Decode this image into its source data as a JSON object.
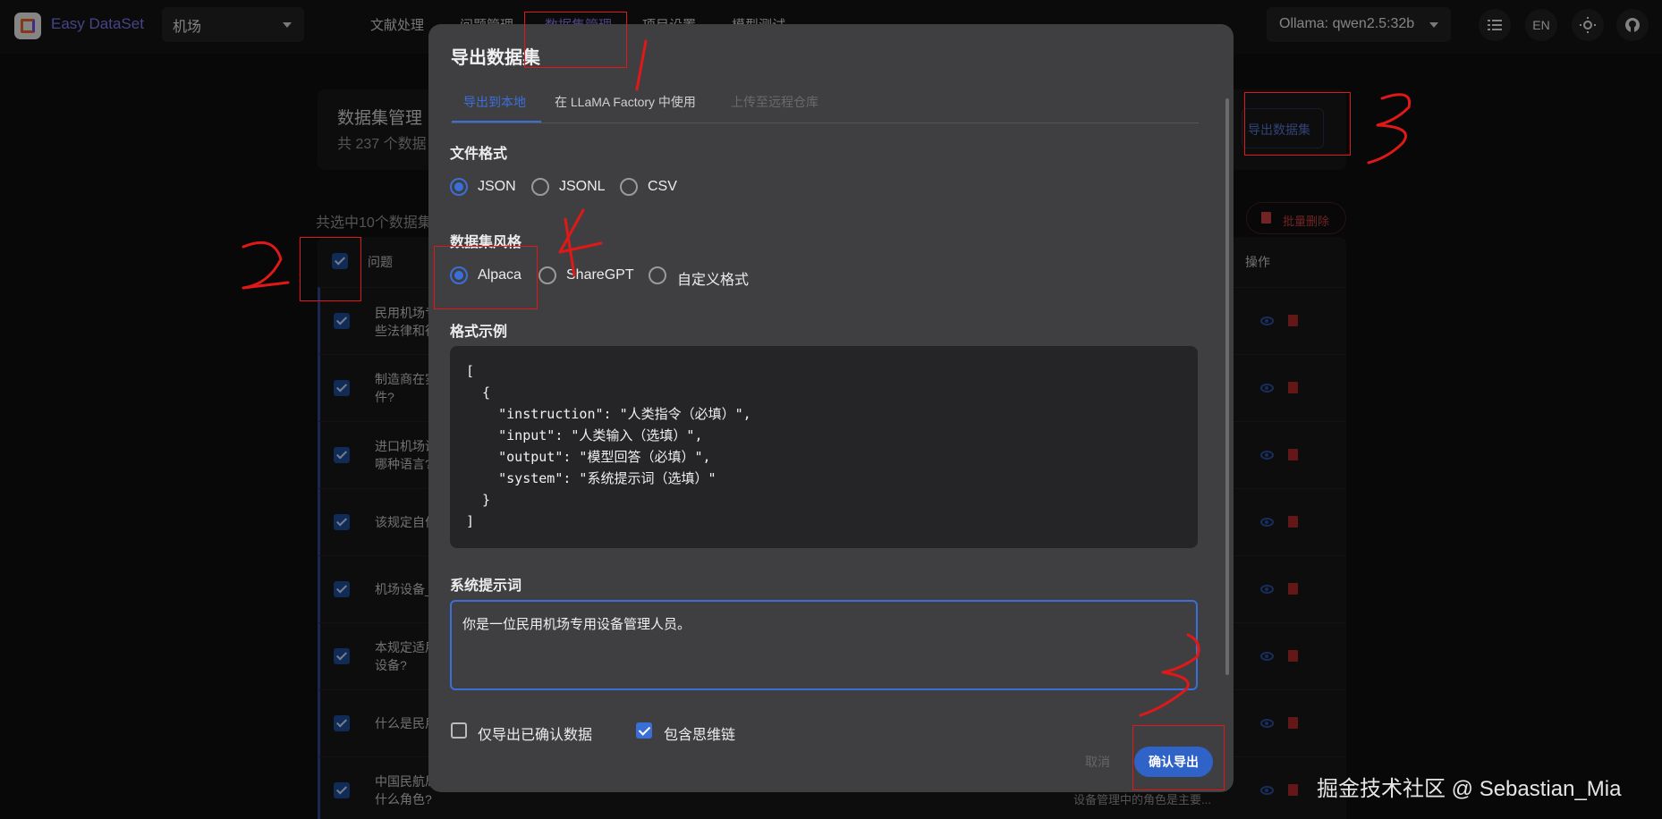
{
  "app": {
    "name": "Easy DataSet",
    "project": "机场"
  },
  "nav": [
    "文献处理",
    "问题管理",
    "数据集管理",
    "项目设置",
    "模型测试"
  ],
  "model": "Ollama: qwen2.5:32b",
  "lang": "EN",
  "page": {
    "title": "数据集管理",
    "subtitle": "共 237 个数据",
    "export_button": "导出数据集",
    "selected": "共选中10个数据集",
    "bulk_delete": "批量删除",
    "col_question": "问题",
    "col_actions": "操作",
    "rows": [
      {
        "l1": "民用机场专",
        "l2": "些法律和行"
      },
      {
        "l1": "制造商在实",
        "l2": "件?"
      },
      {
        "l1": "进口机场设",
        "l2": "哪种语言?"
      },
      {
        "l1": "该规定自何",
        "l2": ""
      },
      {
        "l1": "机场设备_",
        "l2": ""
      },
      {
        "l1": "本规定适用",
        "l2": "设备?"
      },
      {
        "l1": "什么是民用",
        "l2": ""
      },
      {
        "l1": "中国民航局",
        "l2": "什么角色?"
      }
    ],
    "row_tail": "设备管理中的角色是主要..."
  },
  "dialog": {
    "title": "导出数据集",
    "tabs": [
      "导出到本地",
      "在 LLaMA Factory 中使用",
      "上传至远程仓库"
    ],
    "file_format_label": "文件格式",
    "file_formats": [
      "JSON",
      "JSONL",
      "CSV"
    ],
    "file_format_selected": "JSON",
    "style_label": "数据集风格",
    "styles": [
      "Alpaca",
      "ShareGPT",
      "自定义格式"
    ],
    "style_selected": "Alpaca",
    "example_label": "格式示例",
    "example_lines": [
      "[",
      "  {",
      "    \"instruction\": \"人类指令（必填）\",",
      "    \"input\": \"人类输入（选填）\",",
      "    \"output\": \"模型回答（必填）\",",
      "    \"system\": \"系统提示词（选填）\"",
      "  }",
      "]"
    ],
    "system_prompt_label": "系统提示词",
    "system_prompt_value": "你是一位民用机场专用设备管理人员。",
    "only_confirmed": "仅导出已确认数据",
    "only_confirmed_checked": false,
    "include_cot": "包含思维链",
    "include_cot_checked": true,
    "cancel": "取消",
    "confirm": "确认导出"
  },
  "watermark": "掘金技术社区 @ Sebastian_Mia",
  "colors": {
    "accent": "#3b6fd8",
    "nav_active": "#8b7cf6",
    "annotation": "#e01818"
  }
}
